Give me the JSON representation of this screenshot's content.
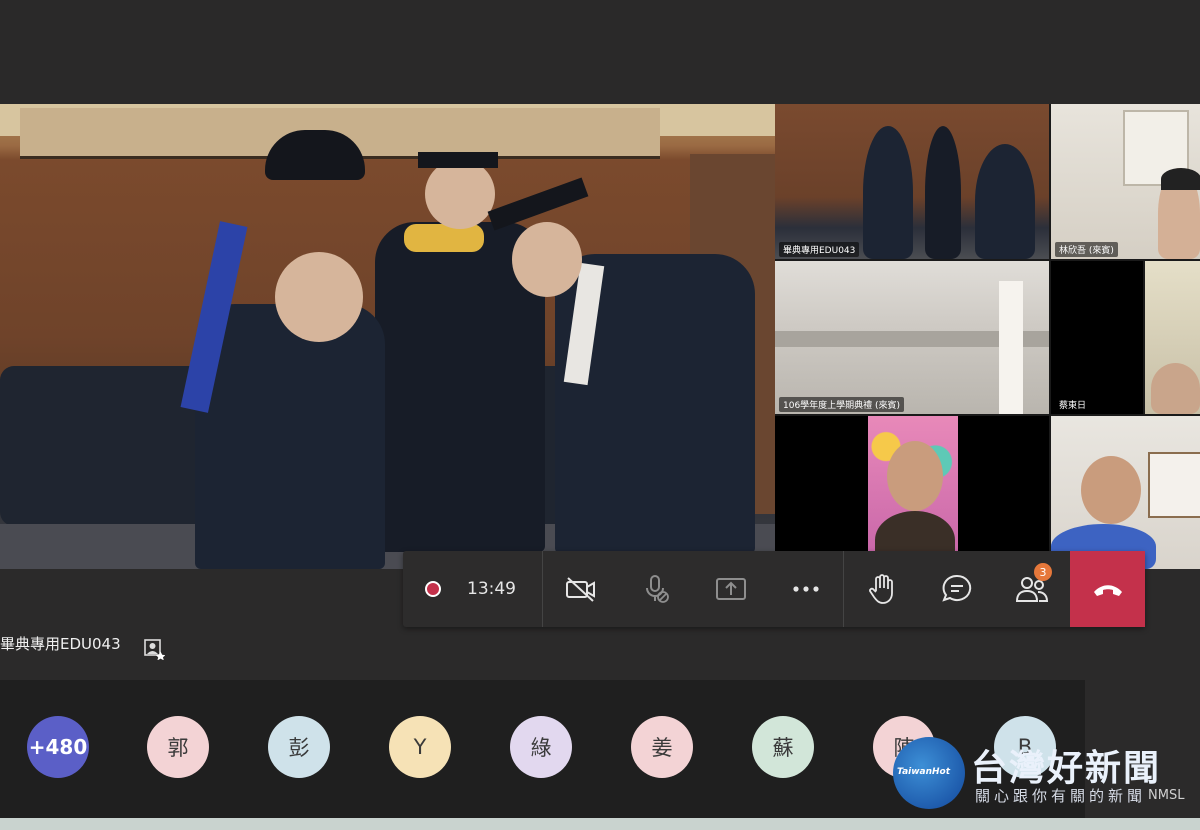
{
  "main_video": {
    "name_label": "畢典專用EDU043"
  },
  "tiles": [
    {
      "name": "畢典專用EDU043"
    },
    {
      "name": "林欣吾 (來賓)"
    },
    {
      "name": "106學年度上學期典禮 (來賓)"
    },
    {
      "name": "蔡東日"
    }
  ],
  "controls": {
    "timer": "13:49",
    "participant_badge": "3",
    "colors": {
      "record": "#c4314b",
      "hangup": "#c4314b",
      "badge": "#e6783b"
    }
  },
  "avatars": [
    {
      "label": "+480",
      "color": "#5b5fc7"
    },
    {
      "label": "郭",
      "color": "#f3d3d5"
    },
    {
      "label": "彭",
      "color": "#cfe2ea"
    },
    {
      "label": "Y",
      "color": "#f6e2b6"
    },
    {
      "label": "綠",
      "color": "#e2d8ef"
    },
    {
      "label": "姜",
      "color": "#f3d3d5"
    },
    {
      "label": "蘇",
      "color": "#d2e6d9"
    },
    {
      "label": "陳",
      "color": "#f3d3d5"
    },
    {
      "label": "B",
      "color": "#cfe2ea"
    }
  ],
  "watermark": {
    "title": "台灣好新聞",
    "subtitle": "關心跟你有關的新聞",
    "logo_text": "TaiwanHot",
    "code": "NMSL"
  }
}
